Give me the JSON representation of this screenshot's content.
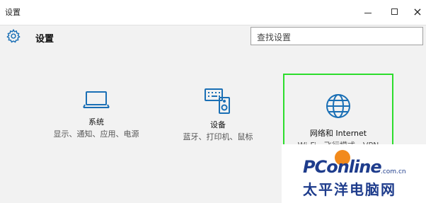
{
  "window": {
    "title": "设置",
    "min_icon": "minimize-icon",
    "max_icon": "maximize-icon",
    "close_label": "×"
  },
  "header": {
    "title": "设置",
    "icon": "gear-icon"
  },
  "search": {
    "placeholder": "查找设置"
  },
  "tiles": [
    {
      "icon": "laptop-icon",
      "name": "系统",
      "desc": "显示、通知、应用、电源"
    },
    {
      "icon": "keyboard-speaker-icon",
      "name": "设备",
      "desc": "蓝牙、打印机、鼠标"
    },
    {
      "icon": "globe-icon",
      "name": "网络和 Internet",
      "desc": "Wi-Fi、飞行模式、VPN",
      "highlighted": true
    }
  ],
  "colors": {
    "accent": "#1a6fb5",
    "highlight_border": "#2ddd2d",
    "watermark": "#1e3c8c"
  },
  "watermark": {
    "brand": "PConline",
    "domain": ".com.cn",
    "cn": "太平洋电脑网"
  }
}
